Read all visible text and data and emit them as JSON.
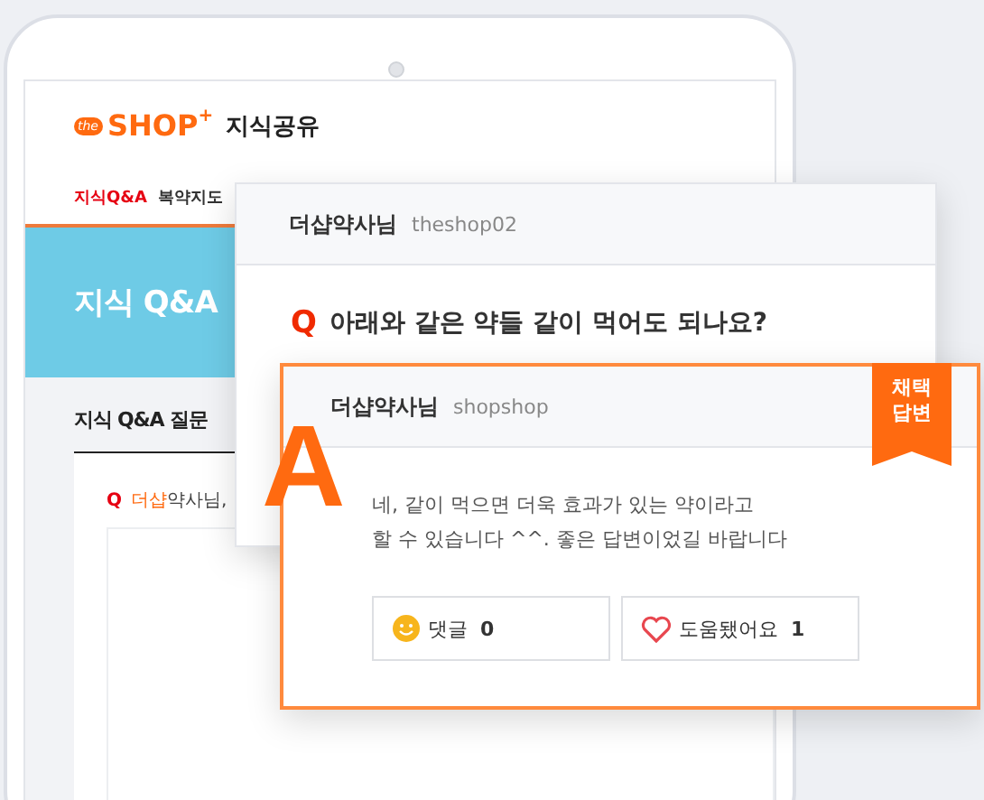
{
  "site": {
    "logo_badge": "the",
    "brand": "SHOP",
    "brand_mark": "+",
    "title": "지식공유"
  },
  "nav": [
    {
      "label": "지식Q&A",
      "selected": true
    },
    {
      "label": "복약지도",
      "selected": false
    }
  ],
  "banner": {
    "title": "지식 Q&A"
  },
  "section": {
    "heading": "지식 Q&A 질문",
    "marker": "Q",
    "author_highlight": "더샵",
    "author_rest": "약사님,"
  },
  "question": {
    "author": "더샵약사님",
    "user_id": "theshop02",
    "marker": "Q",
    "text": "아래와 같은 약들 같이 먹어도 되나요?"
  },
  "answer": {
    "author": "더샵약사님",
    "user_id": "shopshop",
    "badge": [
      "채택",
      "답변"
    ],
    "marker": "A",
    "text_lines": [
      "네, 같이 먹으면 더욱 효과가 있는 약이라고",
      "할 수 있습니다 ^^. 좋은 답변이었길 바랍니다"
    ],
    "actions": [
      {
        "kind": "comment",
        "label": "댓글",
        "count": "0"
      },
      {
        "kind": "helpful",
        "label": "도움됐어요",
        "count": "1"
      }
    ]
  }
}
